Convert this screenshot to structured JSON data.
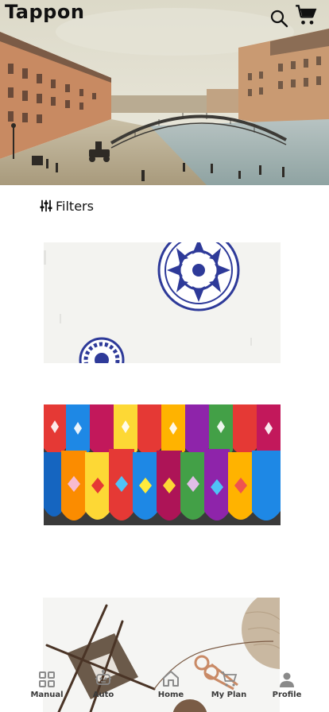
{
  "app": {
    "brand": "Tappon"
  },
  "header": {
    "search_icon": "search-icon",
    "cart_icon": "cart-icon"
  },
  "hero": {
    "image": "illustration of a city river with an arched bridge and buildings"
  },
  "filters": {
    "label": "Filters",
    "icon": "sliders-icon"
  },
  "products": [
    {
      "image": "blue and white ceramic plates on a white wall"
    },
    {
      "image": "rows of colorful embroidered slippers"
    },
    {
      "image": "knitting needles, yarn and scissors on white"
    }
  ],
  "bottom_nav": {
    "items": [
      {
        "label": "Manual",
        "icon": "grid-icon"
      },
      {
        "label": "Auto",
        "icon": "robot-icon"
      },
      {
        "label": "Home",
        "icon": "home-icon"
      },
      {
        "label": "My Plan",
        "icon": "cart-icon"
      },
      {
        "label": "Profile",
        "icon": "user-icon"
      }
    ]
  },
  "colors": {
    "text": "#111111",
    "nav_label": "#3a3a3a",
    "nav_icon": "#8a8a8a"
  }
}
